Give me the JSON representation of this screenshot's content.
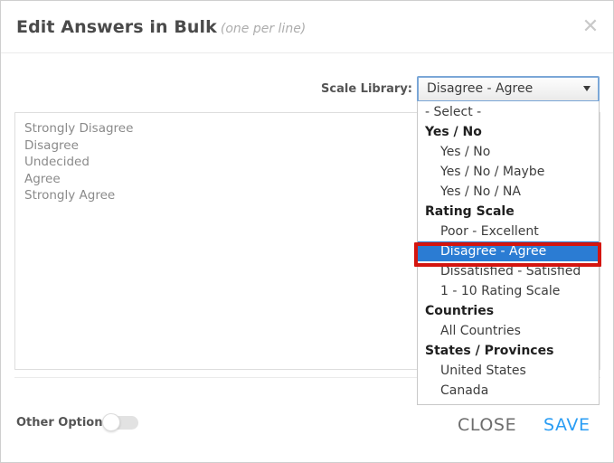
{
  "dialog": {
    "title": "Edit Answers in Bulk",
    "subtitle": "(one per line)",
    "close_icon": "close-x-icon"
  },
  "scale_library": {
    "label": "Scale Library:",
    "selected_value": "Disagree - Agree",
    "arrow_icon": "chevron-down-icon",
    "options": [
      {
        "label": "- Select -",
        "type": "plain",
        "selected": false
      },
      {
        "label": "Yes / No",
        "type": "group",
        "selected": false
      },
      {
        "label": "Yes / No",
        "type": "option",
        "selected": false
      },
      {
        "label": "Yes / No / Maybe",
        "type": "option",
        "selected": false
      },
      {
        "label": "Yes / No / NA",
        "type": "option",
        "selected": false
      },
      {
        "label": "Rating Scale",
        "type": "group",
        "selected": false
      },
      {
        "label": "Poor - Excellent",
        "type": "option",
        "selected": false
      },
      {
        "label": "Disagree - Agree",
        "type": "option",
        "selected": true
      },
      {
        "label": "Dissatisfied - Satisfied",
        "type": "option",
        "selected": false
      },
      {
        "label": "1 - 10 Rating Scale",
        "type": "option",
        "selected": false
      },
      {
        "label": "Countries",
        "type": "group",
        "selected": false
      },
      {
        "label": "All Countries",
        "type": "option",
        "selected": false
      },
      {
        "label": "States / Provinces",
        "type": "group",
        "selected": false
      },
      {
        "label": "United States",
        "type": "option",
        "selected": false
      },
      {
        "label": "Canada",
        "type": "option",
        "selected": false
      }
    ]
  },
  "answers": {
    "lines": [
      "Strongly Disagree",
      "Disagree",
      "Undecided",
      "Agree",
      "Strongly Agree"
    ]
  },
  "footer": {
    "other_option_label": "Other Option",
    "other_option_on": false,
    "close_label": "CLOSE",
    "save_label": "SAVE"
  },
  "colors": {
    "highlight_blue": "#2b7cd3",
    "annotation_red": "#d4150f",
    "save_blue": "#2a9df4",
    "focus_border_blue": "#7ba7d7"
  }
}
